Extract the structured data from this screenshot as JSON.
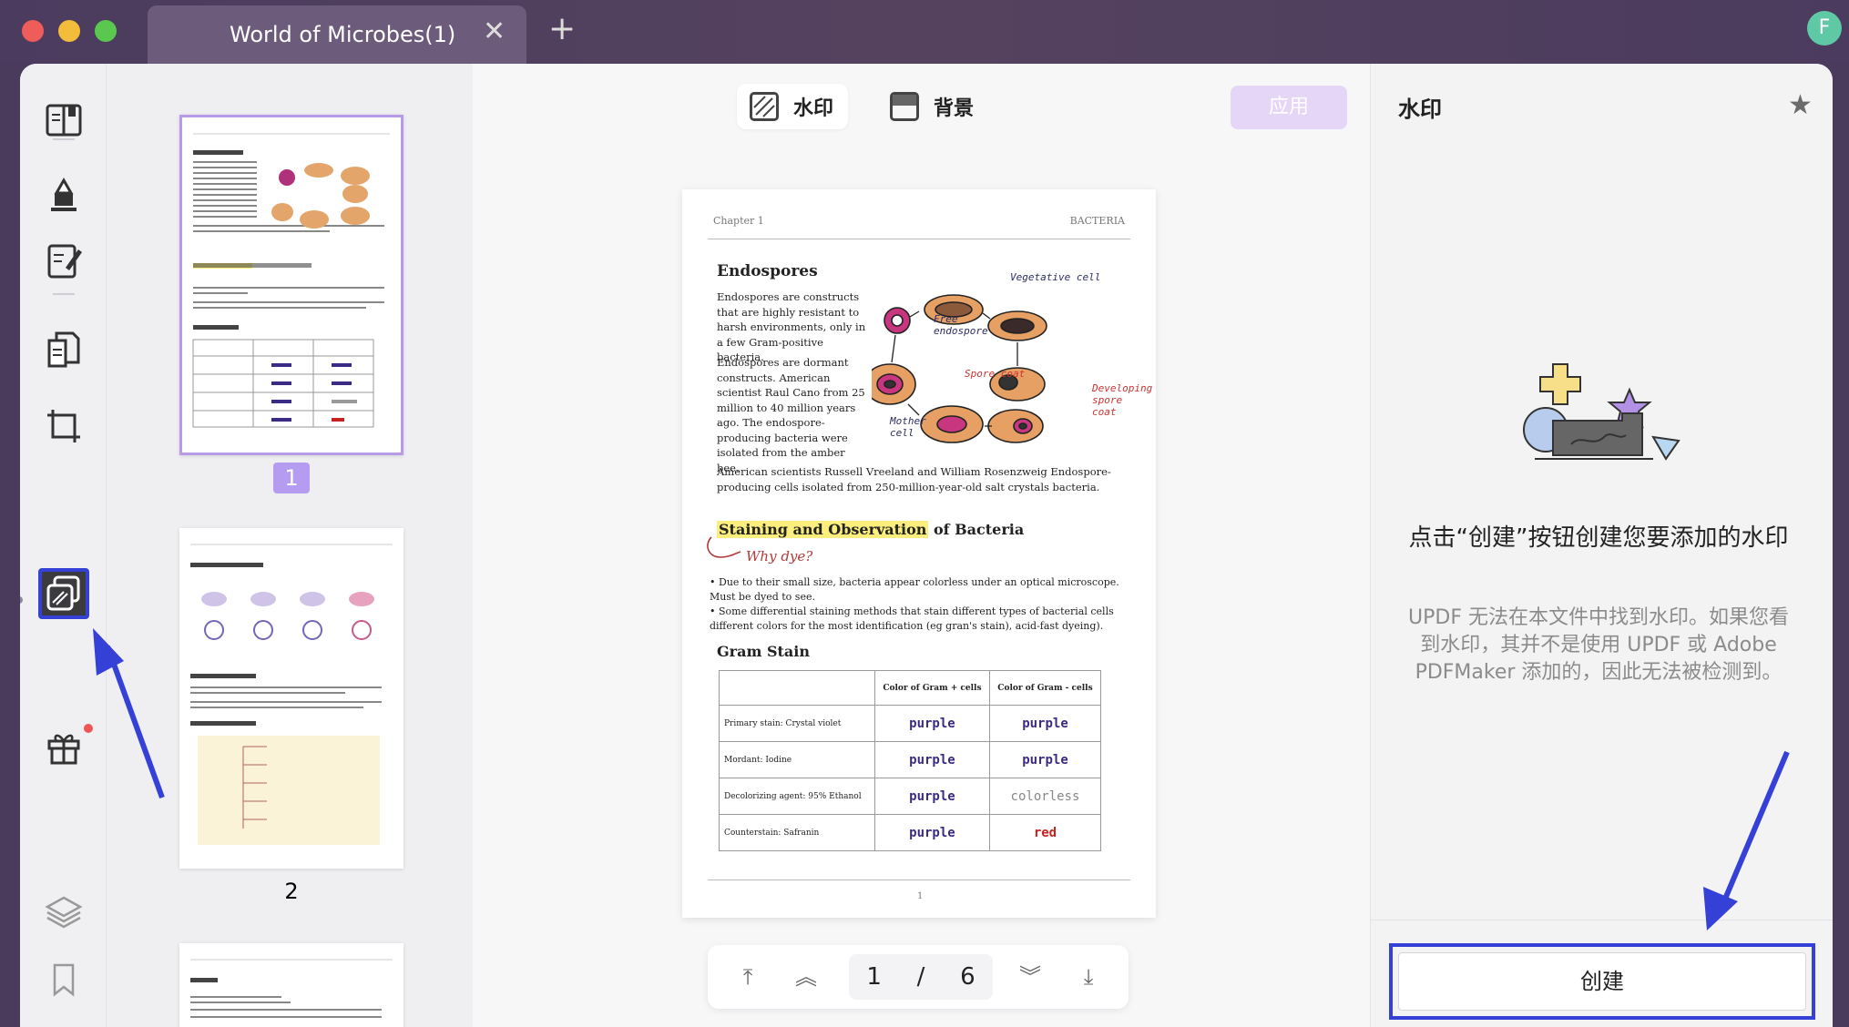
{
  "tab": {
    "title": "World of Microbes(1)",
    "close": "✕",
    "add": "+"
  },
  "user": {
    "avatar_initial": "F"
  },
  "toolbar": {
    "watermark_label": "水印",
    "background_label": "背景",
    "apply_label": "应用"
  },
  "thumbnails": {
    "page1_label": "1",
    "page2_label": "2"
  },
  "pager": {
    "current": "1",
    "separator": "/",
    "total": "6"
  },
  "panel": {
    "title": "水印",
    "headline": "点击“创建”按钮创建您要添加的水印",
    "description": "UPDF 无法在本文件中找到水印。如果您看到水印，其并不是使用 UPDF 或 Adobe PDFMaker 添加的，因此无法被检测到。",
    "create_label": "创建"
  },
  "document": {
    "header_left": "Chapter 1",
    "header_right": "BACTERIA",
    "heading_endospores": "Endospores",
    "endo_p1": "Endospores are constructs that are highly resistant to harsh environments, only in a few Gram-positive bacteria.",
    "endo_p2": "Endospores are dormant constructs. American scientist Raul Cano from 25 million to 40 million years ago. The endospore-producing bacteria were isolated from the amber bee.",
    "endo_p3": "American scientists Russell Vreeland and William Rosenzweig Endospore-producing cells isolated from 250-million-year-old salt crystals bacteria.",
    "annot_vegetative": "Vegetative cell",
    "annot_free": "Free endospore",
    "annot_spore_coat": "Spore coat",
    "annot_developing": "Developing spore coat",
    "annot_mother": "Mother cell",
    "heading_staining_hl": "Staining and Observation",
    "heading_staining_rest": " of Bacteria",
    "why_dye": "Why dye?",
    "bullet1": "Due to their small size, bacteria appear colorless under an optical microscope. Must be dyed to see.",
    "bullet2": "Some differential staining methods that stain different types of bacterial cells different colors for the most identification (eg gran's stain), acid-fast dyeing).",
    "heading_gram": "Gram Stain",
    "table_headers": [
      "",
      "Color of Gram + cells",
      "Color of Gram - cells"
    ],
    "table_rows": [
      {
        "label": "Primary stain: Crystal violet",
        "pos": "purple",
        "neg": "purple"
      },
      {
        "label": "Mordant: Iodine",
        "pos": "purple",
        "neg": "purple"
      },
      {
        "label": "Decolorizing agent: 95% Ethanol",
        "pos": "purple",
        "neg": "colorless"
      },
      {
        "label": "Counterstain: Safranin",
        "pos": "purple",
        "neg": "red"
      }
    ],
    "page_number": "1"
  },
  "colors": {
    "accent_blue": "#3440d6",
    "thumb_selected": "#b69cf0",
    "apply_disabled": "#e5d6f8",
    "handwriting_purple": "#3b2a86",
    "handwriting_red": "#c72222"
  }
}
